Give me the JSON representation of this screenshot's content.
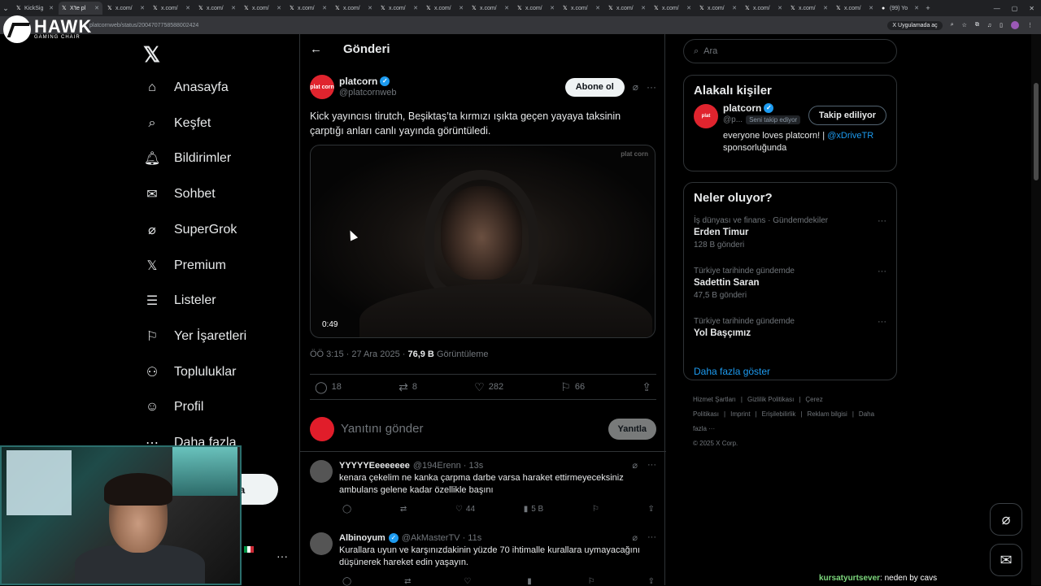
{
  "browser": {
    "tabs": [
      {
        "label": "KickSig",
        "active": false
      },
      {
        "label": "X'te pl",
        "active": true
      },
      {
        "label": "x.com/",
        "active": false
      },
      {
        "label": "x.com/",
        "active": false
      },
      {
        "label": "x.com/",
        "active": false
      },
      {
        "label": "x.com/",
        "active": false
      },
      {
        "label": "x.com/",
        "active": false
      },
      {
        "label": "x.com/",
        "active": false
      },
      {
        "label": "x.com/",
        "active": false
      },
      {
        "label": "x.com/",
        "active": false
      },
      {
        "label": "x.com/",
        "active": false
      },
      {
        "label": "x.com/",
        "active": false
      },
      {
        "label": "x.com/",
        "active": false
      },
      {
        "label": "x.com/",
        "active": false
      },
      {
        "label": "x.com/",
        "active": false
      },
      {
        "label": "x.com/",
        "active": false
      },
      {
        "label": "x.com/",
        "active": false
      },
      {
        "label": "x.com/",
        "active": false
      },
      {
        "label": "x.com/",
        "active": false
      },
      {
        "label": "(99) Yo",
        "active": false
      }
    ],
    "url": "platcornweb/status/2004707758588002424",
    "open_in_app": "Uygulamada aç"
  },
  "overlay": {
    "brand": "HAWK",
    "brand_sub": "GAMING CHAIR",
    "chat_user": "kursatyurtsever",
    "chat_message": ": neden by cavs"
  },
  "nav": {
    "items": [
      {
        "label": "Anasayfa",
        "icon": "home-icon"
      },
      {
        "label": "Keşfet",
        "icon": "search-icon"
      },
      {
        "label": "Bildirimler",
        "icon": "bell-icon"
      },
      {
        "label": "Sohbet",
        "icon": "mail-icon"
      },
      {
        "label": "SuperGrok",
        "icon": "grok-icon"
      },
      {
        "label": "Premium",
        "icon": "x-icon"
      },
      {
        "label": "Listeler",
        "icon": "list-icon"
      },
      {
        "label": "Yer İşaretleri",
        "icon": "bookmark-icon"
      },
      {
        "label": "Topluluklar",
        "icon": "communities-icon"
      },
      {
        "label": "Profil",
        "icon": "profile-icon"
      },
      {
        "label": "Daha fazla",
        "icon": "more-icon"
      }
    ],
    "post_button_fragment": "a"
  },
  "post": {
    "header_title": "Gönderi",
    "author_name": "platcorn",
    "author_handle": "@platcornweb",
    "avatar_text": "plat corn",
    "follow_label": "Abone ol",
    "text": "Kick yayıncısı tirutch, Beşiktaş’ta kırmızı ışıkta geçen yayaya taksinin çarptığı anları canlı yayında görüntüledi.",
    "video_duration": "0:49",
    "video_watermark": "plat corn",
    "time": "ÖÖ 3:15 · 27 Ara 2025 · ",
    "views": "76,9 B",
    "views_label": " Görüntüleme",
    "stats": {
      "replies": "18",
      "reposts": "8",
      "likes": "282",
      "bookmarks": "66"
    }
  },
  "reply_box": {
    "placeholder": "Yanıtını gönder",
    "button": "Yanıtla"
  },
  "replies": [
    {
      "name": "YYYYYEeeeeeee",
      "handle": "@194Erenn · 13s",
      "verified": false,
      "text": "kenara çekelim ne kanka çarpma darbe varsa haraket ettirmeyeceksiniz ambulans gelene kadar özellikle başını",
      "likes": "44",
      "views": "5 B"
    },
    {
      "name": "Albinoyum",
      "handle": "@AkMasterTV · 11s",
      "verified": true,
      "text": "Kurallara uyun ve karşınızdakinin yüzde 70 ihtimalle kurallara uymayacağını düşünerek hareket edin yaşayın.",
      "likes": "",
      "views": ""
    }
  ],
  "sidebar": {
    "search_placeholder": "Ara",
    "related_title": "Alakalı kişiler",
    "related": {
      "name": "platcorn",
      "handle": "@p...",
      "follows_you": "Seni takip ediyor",
      "button": "Takip ediliyor",
      "bio_text": "everyone loves platcorn! | ",
      "bio_link": "@xDriveTR",
      "bio_tail": "sponsorluğunda"
    },
    "trends_title": "Neler oluyor?",
    "trends": [
      {
        "context": "İş dünyası ve finans · Gündemdekiler",
        "name": "Erden Timur",
        "count": "128 B gönderi"
      },
      {
        "context": "Türkiye tarihinde gündemde",
        "name": "Sadettin Saran",
        "count": "47,5 B gönderi"
      },
      {
        "context": "Türkiye tarihinde gündemde",
        "name": "Yol Başçımız",
        "count": ""
      }
    ],
    "show_more": "Daha fazla göster",
    "footer": [
      "Hizmet Şartları",
      "|",
      "Gizlilik Politikası",
      "|",
      "Çerez Politikası",
      "|",
      "Imprint",
      "|",
      "Erişilebilirlik",
      "|",
      "Reklam bilgisi",
      "|",
      "Daha fazla ···",
      "© 2025 X Corp."
    ]
  }
}
